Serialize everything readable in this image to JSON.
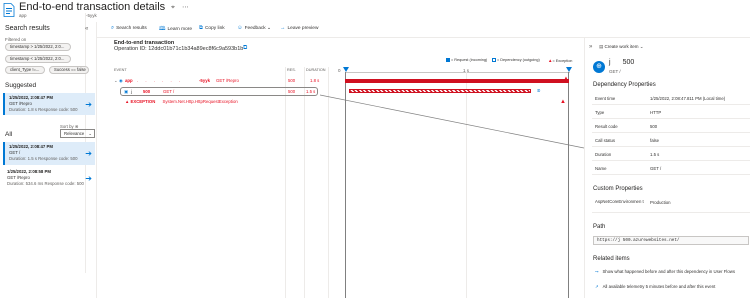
{
  "header": {
    "title": "End-to-end transaction details",
    "subtitle_left": "app",
    "subtitle_right": "-5yyk",
    "pin_icon": "pin-icon",
    "more_icon": "ellipsis-icon"
  },
  "left": {
    "title": "Search results",
    "filtered_on": "Filtered on",
    "filters": [
      "timestamp > 1/25/2022, 2:0...",
      "timestamp < 1/25/2022, 2:0...",
      "client_Type !=...",
      "Success == false"
    ],
    "suggested_title": "Suggested",
    "suggested": [
      {
        "time": "1/25/2022, 2:08:47 PM",
        "name": "GET /Repro",
        "duration": "Duration: 1.8 s",
        "response": "Response code: 500"
      }
    ],
    "all_title": "All",
    "sort_by": "Sort by ⊗",
    "sort_value": "Relevance",
    "all": [
      {
        "time": "1/25/2022, 2:08:47 PM",
        "name": "GET /",
        "duration": "Duration: 1.5 s",
        "response": "Response code: 500"
      },
      {
        "time": "1/25/2022, 2:08:58 PM",
        "name": "GET /Repro",
        "duration": "Duration: 534.6 ms",
        "response": "Response code: 500"
      }
    ]
  },
  "toolbar": {
    "search_results": "Search results",
    "learn_more": "Learn more",
    "copy_link": "Copy link",
    "feedback": "Feedback",
    "leave_preview": "Leave preview"
  },
  "main": {
    "title": "End-to-end transaction",
    "operation_id": "Operation ID: 12ddc01b71c1b34a89ec8f6c9a593b1b",
    "legend": {
      "request": "= Request (incoming)",
      "dependency": "= Dependency (outgoing)",
      "exception": "= Exception"
    },
    "columns": {
      "event": "EVENT",
      "res": "RES.",
      "duration": "DURATION"
    },
    "ticks": {
      "zero": "0",
      "mid": "1 s"
    },
    "rows": [
      {
        "name": "app",
        "name_tail": "-5yyk",
        "op": "GET /Repro",
        "res": "500",
        "duration": "1.8 s"
      },
      {
        "name": "j",
        "code": "500",
        "op": "GET /",
        "res": "500",
        "duration": "1.5 s"
      }
    ],
    "exception": {
      "label": "EXCEPTION",
      "type": "System.Net.Http.HttpRequestException"
    }
  },
  "right": {
    "create_work_item": "Create work item",
    "dep_name": "j",
    "dep_code": "500",
    "dep_method": "GET /",
    "props_title": "Dependency Properties",
    "props": [
      {
        "k": "Event time",
        "v": "1/25/2022, 2:08:47.811 PM (Local time)"
      },
      {
        "k": "Type",
        "v": "HTTP"
      },
      {
        "k": "Result code",
        "v": "500"
      },
      {
        "k": "Call status",
        "v": "false"
      },
      {
        "k": "Duration",
        "v": "1.5 s"
      },
      {
        "k": "Name",
        "v": "GET /"
      }
    ],
    "custom_title": "Custom Properties",
    "custom": [
      {
        "k": "AspNetCoreEnvironmen t",
        "v": "Production"
      }
    ],
    "path_title": "Path",
    "path_value": "https://j      500.azurewebsites.net/",
    "related_title": "Related items",
    "related": [
      "Show what happened before and after this dependency in User Flows",
      "All available telemetry 5 minutes before and after this event"
    ]
  },
  "colors": {
    "accent": "#0078d4",
    "error": "#e81123",
    "bar": "#d01020"
  }
}
